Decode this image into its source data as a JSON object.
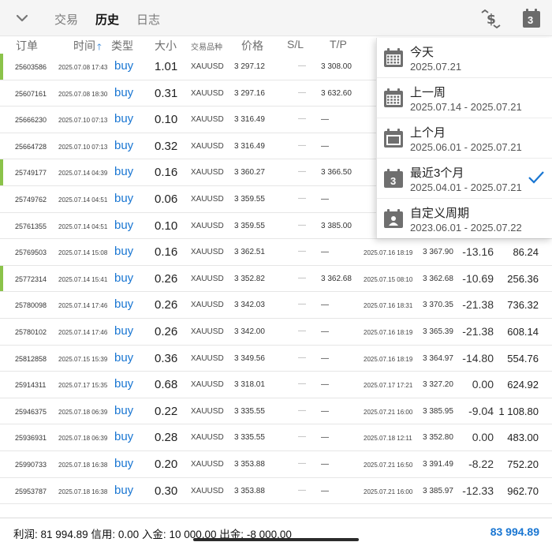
{
  "tabs": [
    {
      "label": "交易"
    },
    {
      "label": "历史"
    },
    {
      "label": "日志"
    }
  ],
  "header": {
    "order": "订单",
    "time": "时间",
    "type": "类型",
    "volume": "大小",
    "symbol": "交易品种",
    "price": "价格",
    "sl": "S/L",
    "tp": "T/P"
  },
  "rows": [
    {
      "id": "25603586",
      "open_time": "2025.07.08 17:43",
      "type": "buy",
      "volume": "1.01",
      "symbol": "XAUUSD",
      "price": "3 297.12",
      "sl": "—",
      "tp": "3 308.00",
      "close_time": "",
      "close_price": "",
      "swap": "",
      "profit": "",
      "mark": "#8bc34a"
    },
    {
      "id": "25607161",
      "open_time": "2025.07.08 18:30",
      "type": "buy",
      "volume": "0.31",
      "symbol": "XAUUSD",
      "price": "3 297.16",
      "sl": "—",
      "tp": "3 632.60",
      "close_time": "",
      "close_price": "",
      "swap": "",
      "profit": "",
      "mark": ""
    },
    {
      "id": "25666230",
      "open_time": "2025.07.10 07:13",
      "type": "buy",
      "volume": "0.10",
      "symbol": "XAUUSD",
      "price": "3 316.49",
      "sl": "—",
      "tp": "—",
      "close_time": "",
      "close_price": "",
      "swap": "",
      "profit": "",
      "mark": ""
    },
    {
      "id": "25664728",
      "open_time": "2025.07.10 07:13",
      "type": "buy",
      "volume": "0.32",
      "symbol": "XAUUSD",
      "price": "3 316.49",
      "sl": "—",
      "tp": "—",
      "close_time": "",
      "close_price": "",
      "swap": "",
      "profit": "",
      "mark": ""
    },
    {
      "id": "25749177",
      "open_time": "2025.07.14 04:39",
      "type": "buy",
      "volume": "0.16",
      "symbol": "XAUUSD",
      "price": "3 360.27",
      "sl": "—",
      "tp": "3 366.50",
      "close_time": "",
      "close_price": "",
      "swap": "",
      "profit": "",
      "mark": "#8bc34a"
    },
    {
      "id": "25749762",
      "open_time": "2025.07.14 04:51",
      "type": "buy",
      "volume": "0.06",
      "symbol": "XAUUSD",
      "price": "3 359.55",
      "sl": "—",
      "tp": "—",
      "close_time": "",
      "close_price": "",
      "swap": "",
      "profit": "",
      "mark": ""
    },
    {
      "id": "25761355",
      "open_time": "2025.07.14 04:51",
      "type": "buy",
      "volume": "0.10",
      "symbol": "XAUUSD",
      "price": "3 359.55",
      "sl": "—",
      "tp": "3 385.00",
      "close_time": "",
      "close_price": "",
      "swap": "",
      "profit": "",
      "mark": ""
    },
    {
      "id": "25769503",
      "open_time": "2025.07.14 15:08",
      "type": "buy",
      "volume": "0.16",
      "symbol": "XAUUSD",
      "price": "3 362.51",
      "sl": "—",
      "tp": "—",
      "close_time": "2025.07.16 18:19",
      "close_price": "3 367.90",
      "swap": "-13.16",
      "profit": "86.24",
      "mark": ""
    },
    {
      "id": "25772314",
      "open_time": "2025.07.14 15:41",
      "type": "buy",
      "volume": "0.26",
      "symbol": "XAUUSD",
      "price": "3 352.82",
      "sl": "—",
      "tp": "3 362.68",
      "close_time": "2025.07.15 08:10",
      "close_price": "3 362.68",
      "swap": "-10.69",
      "profit": "256.36",
      "mark": "#8bc34a"
    },
    {
      "id": "25780098",
      "open_time": "2025.07.14 17:46",
      "type": "buy",
      "volume": "0.26",
      "symbol": "XAUUSD",
      "price": "3 342.03",
      "sl": "—",
      "tp": "—",
      "close_time": "2025.07.16 18:31",
      "close_price": "3 370.35",
      "swap": "-21.38",
      "profit": "736.32",
      "mark": ""
    },
    {
      "id": "25780102",
      "open_time": "2025.07.14 17:46",
      "type": "buy",
      "volume": "0.26",
      "symbol": "XAUUSD",
      "price": "3 342.00",
      "sl": "—",
      "tp": "—",
      "close_time": "2025.07.16 18:19",
      "close_price": "3 365.39",
      "swap": "-21.38",
      "profit": "608.14",
      "mark": ""
    },
    {
      "id": "25812858",
      "open_time": "2025.07.15 15:39",
      "type": "buy",
      "volume": "0.36",
      "symbol": "XAUUSD",
      "price": "3 349.56",
      "sl": "—",
      "tp": "—",
      "close_time": "2025.07.16 18:19",
      "close_price": "3 364.97",
      "swap": "-14.80",
      "profit": "554.76",
      "mark": ""
    },
    {
      "id": "25914311",
      "open_time": "2025.07.17 15:35",
      "type": "buy",
      "volume": "0.68",
      "symbol": "XAUUSD",
      "price": "3 318.01",
      "sl": "—",
      "tp": "—",
      "close_time": "2025.07.17 17:21",
      "close_price": "3 327.20",
      "swap": "0.00",
      "profit": "624.92",
      "mark": ""
    },
    {
      "id": "25946375",
      "open_time": "2025.07.18 06:39",
      "type": "buy",
      "volume": "0.22",
      "symbol": "XAUUSD",
      "price": "3 335.55",
      "sl": "—",
      "tp": "—",
      "close_time": "2025.07.21 16:00",
      "close_price": "3 385.95",
      "swap": "-9.04",
      "profit": "1 108.80",
      "mark": ""
    },
    {
      "id": "25936931",
      "open_time": "2025.07.18 06:39",
      "type": "buy",
      "volume": "0.28",
      "symbol": "XAUUSD",
      "price": "3 335.55",
      "sl": "—",
      "tp": "—",
      "close_time": "2025.07.18 12:11",
      "close_price": "3 352.80",
      "swap": "0.00",
      "profit": "483.00",
      "mark": ""
    },
    {
      "id": "25990733",
      "open_time": "2025.07.18 16:38",
      "type": "buy",
      "volume": "0.20",
      "symbol": "XAUUSD",
      "price": "3 353.88",
      "sl": "—",
      "tp": "—",
      "close_time": "2025.07.21 16:50",
      "close_price": "3 391.49",
      "swap": "-8.22",
      "profit": "752.20",
      "mark": ""
    },
    {
      "id": "25953787",
      "open_time": "2025.07.18 16:38",
      "type": "buy",
      "volume": "0.30",
      "symbol": "XAUUSD",
      "price": "3 353.88",
      "sl": "—",
      "tp": "—",
      "close_time": "2025.07.21 16:00",
      "close_price": "3 385.97",
      "swap": "-12.33",
      "profit": "962.70",
      "mark": ""
    }
  ],
  "dropdown": [
    {
      "label": "今天",
      "range": "2025.07.21",
      "icon": "calendar-icon",
      "checked": false
    },
    {
      "label": "上一周",
      "range": "2025.07.14 - 2025.07.21",
      "icon": "calendar-week-icon",
      "checked": false
    },
    {
      "label": "上个月",
      "range": "2025.06.01 - 2025.07.21",
      "icon": "calendar-month-icon",
      "checked": false
    },
    {
      "label": "最近3个月",
      "range": "2025.04.01 - 2025.07.21",
      "icon": "calendar-3-icon",
      "checked": true,
      "icon_text": "3"
    },
    {
      "label": "自定义周期",
      "range": "2023.06.01 - 2025.07.22",
      "icon": "calendar-custom-icon",
      "checked": false
    }
  ],
  "footer": {
    "profit_label": "利润:",
    "profit": "81 994.89",
    "credit_label": "信用:",
    "credit": "0.00",
    "deposit_label": "入金:",
    "deposit": "10 000.00",
    "withdraw_label": "出金:",
    "withdraw": "-8 000.00",
    "balance": "83 994.89"
  },
  "top_icon_text": "3",
  "colors": {
    "accent": "#1976d2",
    "profit_mark": "#8bc34a",
    "loss_mark": "#e53935",
    "icon_gray": "#757575"
  }
}
